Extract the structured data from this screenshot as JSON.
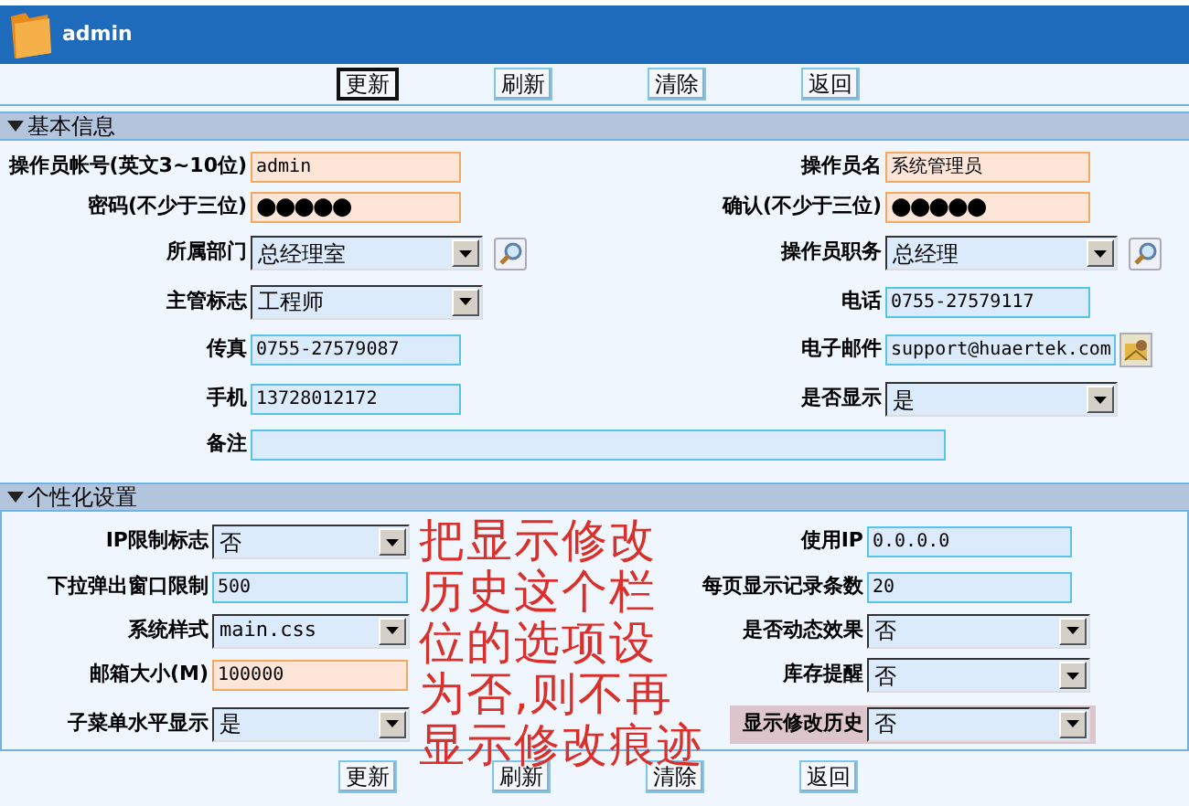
{
  "header": {
    "title": "admin"
  },
  "toolbar_top": [
    {
      "label": "更新",
      "selected": true
    },
    {
      "label": "刷新",
      "selected": false
    },
    {
      "label": "清除",
      "selected": false
    },
    {
      "label": "返回",
      "selected": false
    }
  ],
  "sections": [
    {
      "title": "基本信息",
      "expanded": true,
      "rows": [
        {
          "left": {
            "label": "操作员帐号(英文3~10位)",
            "kind": "text",
            "value": "admin",
            "required": true
          },
          "right": {
            "label": "操作员名",
            "kind": "text",
            "value": "系统管理员",
            "required": true
          }
        },
        {
          "left": {
            "label": "密码(不少于三位)",
            "kind": "password",
            "value": "●●●●●",
            "required": true
          },
          "right": {
            "label": "确认(不少于三位)",
            "kind": "password",
            "value": "●●●●●",
            "required": true
          }
        },
        {
          "left": {
            "label": "所属部门",
            "kind": "select",
            "value": "总经理室",
            "lookup_button": true
          },
          "right": {
            "label": "操作员职务",
            "kind": "select",
            "value": "总经理",
            "lookup_button": true
          }
        },
        {
          "left": {
            "label": "主管标志",
            "kind": "select",
            "value": "工程师"
          },
          "right": {
            "label": "电话",
            "kind": "text",
            "value": "0755-27579117"
          }
        },
        {
          "left": {
            "label": "传真",
            "kind": "text",
            "value": "0755-27579087"
          },
          "right": {
            "label": "电子邮件",
            "kind": "text",
            "value": "support@huaertek.com",
            "mail_button": true
          }
        },
        {
          "left": {
            "label": "手机",
            "kind": "text",
            "value": "13728012172"
          },
          "right": {
            "label": "是否显示",
            "kind": "select",
            "value": "是"
          }
        },
        {
          "left": {
            "label": "备注",
            "kind": "wide"
          }
        }
      ]
    },
    {
      "title": "个性化设置",
      "expanded": true,
      "rows": [
        {
          "left": {
            "label": "IP限制标志",
            "kind": "select",
            "value": "否"
          },
          "right": {
            "label": "使用IP",
            "kind": "text",
            "value": "0.0.0.0"
          }
        },
        {
          "left": {
            "label": "下拉弹出窗口限制",
            "kind": "text",
            "value": "500"
          },
          "right": {
            "label": "每页显示记录条数",
            "kind": "text",
            "value": "20"
          }
        },
        {
          "left": {
            "label": "系统样式",
            "kind": "select",
            "value": "main.css"
          },
          "right": {
            "label": "是否动态效果",
            "kind": "select",
            "value": "否"
          }
        },
        {
          "left": {
            "label": "邮箱大小(M)",
            "kind": "text",
            "value": "100000",
            "required": true
          },
          "right": {
            "label": "库存提醒",
            "kind": "select",
            "value": "否"
          }
        },
        {
          "left": {
            "label": "子菜单水平显示",
            "kind": "select",
            "value": "是"
          },
          "right": {
            "label": "显示修改历史",
            "kind": "select",
            "value": "否",
            "highlighted": true
          }
        }
      ]
    }
  ],
  "toolbar_bottom": [
    {
      "label": "更新",
      "selected": false
    },
    {
      "label": "刷新",
      "selected": false
    },
    {
      "label": "清除",
      "selected": false
    },
    {
      "label": "返回",
      "selected": false
    }
  ],
  "annotation": {
    "lines": [
      "把显示修改",
      "历史这个栏",
      "位的选项设",
      "为否,则不再",
      "显示修改痕迹"
    ]
  }
}
